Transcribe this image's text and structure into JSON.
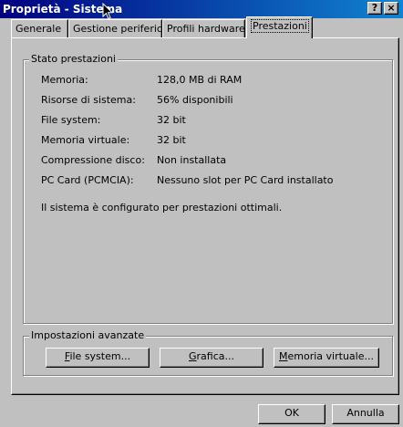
{
  "window": {
    "title": "Proprietà - Sistema",
    "help_label": "?",
    "close_label": "×"
  },
  "tabs": [
    {
      "label": "Generale"
    },
    {
      "label": "Gestione periferiche"
    },
    {
      "label": "Profili hardware"
    },
    {
      "label": "Prestazioni",
      "active": true
    }
  ],
  "status_group": {
    "legend": "Stato prestazioni",
    "rows": [
      {
        "label": "Memoria:",
        "value": "128,0 MB di RAM"
      },
      {
        "label": "Risorse di sistema:",
        "value": "56% disponibili"
      },
      {
        "label": "File system:",
        "value": "32 bit"
      },
      {
        "label": "Memoria virtuale:",
        "value": "32 bit"
      },
      {
        "label": "Compressione disco:",
        "value": "Non installata"
      },
      {
        "label": "PC Card (PCMCIA):",
        "value": "Nessuno slot per PC Card installato"
      }
    ],
    "message": "Il sistema è configurato per prestazioni ottimali."
  },
  "advanced_group": {
    "legend": "Impostazioni avanzate",
    "buttons": {
      "file_system": {
        "mnemonic": "F",
        "rest": "ile system..."
      },
      "graphics": {
        "mnemonic": "G",
        "rest": "rafica..."
      },
      "virtual_memory": {
        "mnemonic": "M",
        "rest": "emoria virtuale..."
      }
    }
  },
  "footer": {
    "ok_label": "OK",
    "cancel_label": "Annulla"
  },
  "icons": {
    "cursor": "mouse-pointer-icon",
    "help": "help-icon",
    "close": "close-icon"
  }
}
